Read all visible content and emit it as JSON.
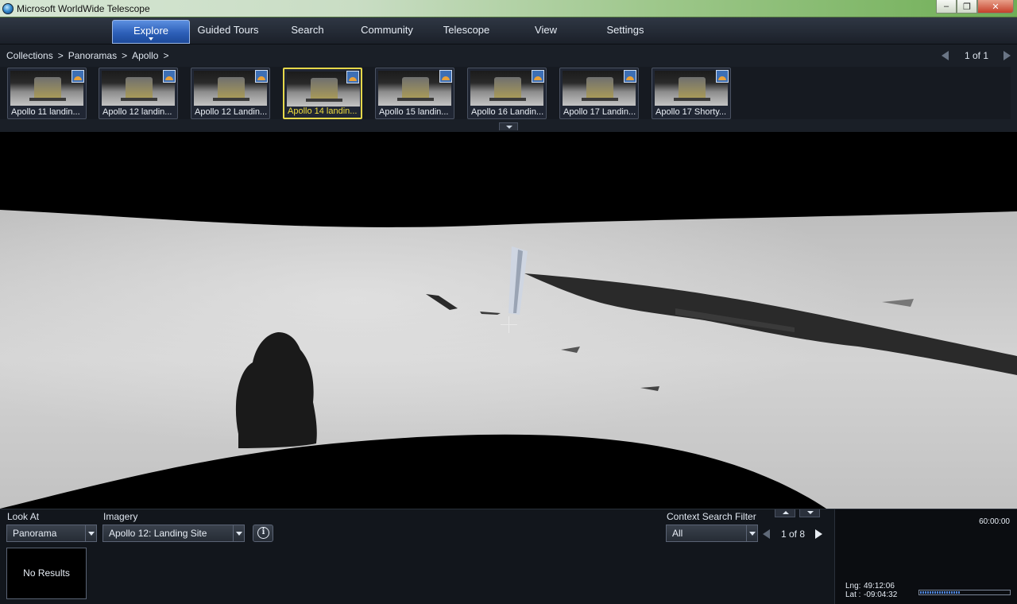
{
  "window": {
    "title": "Microsoft WorldWide Telescope",
    "minimize": "–",
    "maximize": "❐",
    "close": "✕"
  },
  "menu": {
    "tabs": [
      {
        "label": "Explore",
        "active": true
      },
      {
        "label": "Guided Tours"
      },
      {
        "label": "Search"
      },
      {
        "label": "Community"
      },
      {
        "label": "Telescope"
      },
      {
        "label": "View"
      },
      {
        "label": "Settings"
      }
    ]
  },
  "explore": {
    "breadcrumb": [
      "Collections",
      ">",
      "Panoramas",
      ">",
      "Apollo",
      ">"
    ],
    "pager": "1 of 1",
    "thumbnails": [
      {
        "label": "Apollo 11 landin..."
      },
      {
        "label": "Apollo 12 landin..."
      },
      {
        "label": "Apollo 12 Landin..."
      },
      {
        "label": "Apollo 14 landin...",
        "selected": true
      },
      {
        "label": "Apollo 15 landin..."
      },
      {
        "label": "Apollo 16 Landin..."
      },
      {
        "label": "Apollo 17 Landin..."
      },
      {
        "label": "Apollo 17 Shorty..."
      }
    ]
  },
  "bottom": {
    "look_at_label": "Look At",
    "look_at_value": "Panorama",
    "imagery_label": "Imagery",
    "imagery_value": "Apollo 12: Landing Site",
    "info_icon": "i",
    "results_text": "No Results",
    "context_filter_label": "Context Search Filter",
    "context_filter_value": "All",
    "context_pager": "1 of 8"
  },
  "status": {
    "clock": "60:00:00",
    "lng_label": "Lng:",
    "lng_value": "49:12:06",
    "lat_label": "Lat :",
    "lat_value": "-09:04:32",
    "progress_fraction": 0.45
  },
  "colors": {
    "accent_tab": "#2d5fb8",
    "selected_thumb": "#e6d84a",
    "lunar_surface": "#c8c8c8"
  },
  "icons": [
    "app-globe-icon",
    "minimize-icon",
    "maximize-icon",
    "close-icon",
    "prev-page-icon",
    "next-page-icon",
    "collapse-icon",
    "info-icon",
    "dropdown-arrow-icon",
    "crosshair-icon",
    "thumbnail-panorama-icon"
  ]
}
